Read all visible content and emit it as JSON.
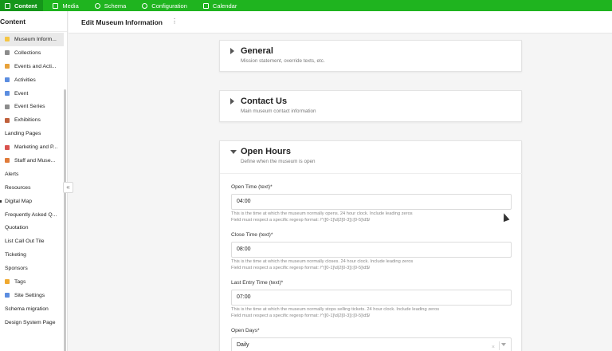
{
  "topnav": [
    {
      "label": "Content",
      "icon": "pencil-icon",
      "active": true
    },
    {
      "label": "Media",
      "icon": "image-icon",
      "active": false
    },
    {
      "label": "Schema",
      "icon": "schema-icon",
      "active": false
    },
    {
      "label": "Configuration",
      "icon": "gear-icon",
      "active": false
    },
    {
      "label": "Calendar",
      "icon": "calendar-icon",
      "active": false
    }
  ],
  "sidebar": {
    "title": "Content",
    "items": [
      {
        "label": "Museum Inform...",
        "icon": "folder-icon",
        "color": "#f5c542"
      },
      {
        "label": "Collections",
        "icon": "museum-icon",
        "color": "#8c8c8c"
      },
      {
        "label": "Events and Acti...",
        "icon": "puzzle-icon",
        "color": "#e8a23a"
      },
      {
        "label": "Activities",
        "icon": "calendar-icon",
        "color": "#5b8de0"
      },
      {
        "label": "Event",
        "icon": "calendar-icon",
        "color": "#5b8de0"
      },
      {
        "label": "Event Series",
        "icon": "list-icon",
        "color": "#8c8c8c"
      },
      {
        "label": "Exhibitions",
        "icon": "frame-icon",
        "color": "#c0603b"
      },
      {
        "label": "Landing Pages",
        "icon": "",
        "color": ""
      },
      {
        "label": "Marketing and P...",
        "icon": "rocket-icon",
        "color": "#d9534f"
      },
      {
        "label": "Staff and Muse...",
        "icon": "people-icon",
        "color": "#e07b39"
      },
      {
        "label": "Alerts",
        "icon": "",
        "color": ""
      },
      {
        "label": "Resources",
        "icon": "",
        "color": ""
      },
      {
        "label": "Digital Map",
        "icon": "",
        "color": ""
      },
      {
        "label": "Frequently Asked Q...",
        "icon": "",
        "color": ""
      },
      {
        "label": "Quotation",
        "icon": "",
        "color": ""
      },
      {
        "label": "List Call Out Tile",
        "icon": "",
        "color": ""
      },
      {
        "label": "Ticketing",
        "icon": "",
        "color": ""
      },
      {
        "label": "Sponsors",
        "icon": "",
        "color": ""
      },
      {
        "label": "Tags",
        "icon": "tag-icon",
        "color": "#f0a92f"
      },
      {
        "label": "Site Settings",
        "icon": "gear-icon",
        "color": "#5b8de0"
      },
      {
        "label": "Schema migration",
        "icon": "",
        "color": ""
      },
      {
        "label": "Design System Page",
        "icon": "",
        "color": ""
      }
    ]
  },
  "header": {
    "title": "Edit Museum Information",
    "menu": "⋮"
  },
  "sections": {
    "general": {
      "title": "General",
      "subtitle": "Mission statement, override texts, etc."
    },
    "contact": {
      "title": "Contact Us",
      "subtitle": "Main museum contact information"
    },
    "hours": {
      "title": "Open Hours",
      "subtitle": "Define when the museum is open"
    }
  },
  "fields": {
    "open_time": {
      "label": "Open Time (text)*",
      "value": "04:00",
      "help1": "This is the time at which the museum normally opens. 24 hour clock. Include leading zeros",
      "help2": "Field must respect a specific regexp format: /^([0-1]\\d|2[0-3]):[0-5]\\d$/"
    },
    "close_time": {
      "label": "Close Time (text)*",
      "value": "08:00",
      "help1": "This is the time at which the museum normally closes. 24 hour clock. Include leading zeros",
      "help2": "Field must respect a specific regexp format: /^([0-1]\\d|2[0-3]):[0-5]\\d$/"
    },
    "last_entry": {
      "label": "Last Entry Time (text)*",
      "value": "07:00",
      "help1": "This is the time at which the museum normally stops selling tickets. 24 hour clock. Include leading zeros",
      "help2": "Field must respect a specific regexp format: /^([0-1]\\d|2[0-3]):[0-5]\\d$/"
    },
    "open_days": {
      "label": "Open Days*",
      "value": "Daily",
      "clear": "×"
    }
  },
  "sidebar_collapse": "«"
}
